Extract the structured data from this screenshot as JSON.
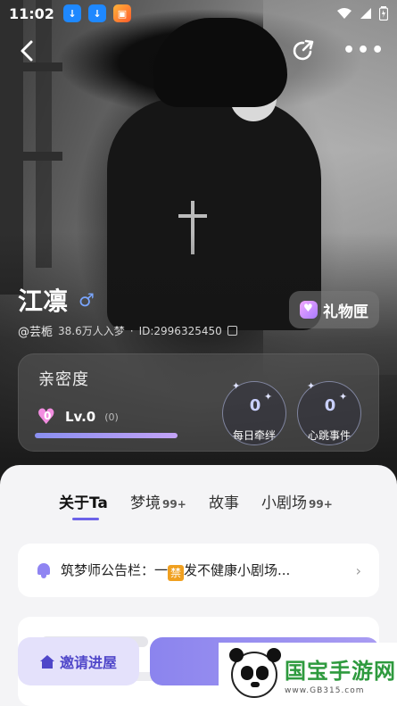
{
  "status_bar": {
    "time": "11:02",
    "notification_icons": [
      "download-icon",
      "download-icon",
      "game-app-icon"
    ],
    "system_icons": [
      "wifi-icon",
      "signal-icon",
      "battery-icon"
    ]
  },
  "nav": {
    "back_icon": "chevron-left-icon",
    "share_icon": "share-icon",
    "more_icon": "more-dots-icon",
    "more_glyph": "•••"
  },
  "profile": {
    "name": "江凛",
    "gender_symbol": "♂",
    "handle": "@芸栀",
    "dream_count": "38.6万人入梦",
    "id_text": "ID:2996325450"
  },
  "gift_button": {
    "label": "礼物匣"
  },
  "intimacy": {
    "title": "亲密度",
    "level_value": "0",
    "level_label": "Lv.0",
    "level_count": "(0)",
    "progress_fraction": 1.0,
    "badges": [
      {
        "value": "0",
        "label": "每日牵绊"
      },
      {
        "value": "0",
        "label": "心跳事件"
      }
    ]
  },
  "tabs": [
    {
      "label": "关于Ta",
      "badge": "",
      "active": true
    },
    {
      "label": "梦境",
      "badge": "99+",
      "active": false
    },
    {
      "label": "故事",
      "badge": "",
      "active": false
    },
    {
      "label": "小剧场",
      "badge": "99+",
      "active": false
    }
  ],
  "notice": {
    "prefix": "筑梦师公告栏：一",
    "ban_char": "禁",
    "suffix": "发不健康小剧场...",
    "chevron": "›"
  },
  "bottom": {
    "invite_label": "邀请进屋"
  },
  "watermark": {
    "title": "国宝手游网",
    "url": "www.GB315.com"
  },
  "colors": {
    "accent": "#6c62e8",
    "invite_text": "#4f46c9",
    "gender": "#7aa6ff",
    "heart": "#f28de0"
  }
}
